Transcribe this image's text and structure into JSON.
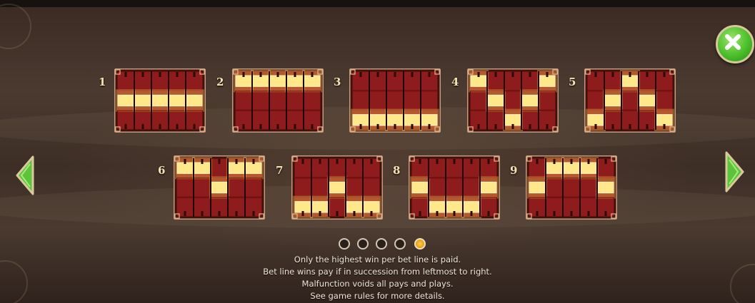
{
  "paylines": [
    {
      "label": "1",
      "rows": [
        1,
        1,
        1,
        1,
        1
      ]
    },
    {
      "label": "2",
      "rows": [
        0,
        0,
        0,
        0,
        0
      ]
    },
    {
      "label": "3",
      "rows": [
        2,
        2,
        2,
        2,
        2
      ]
    },
    {
      "label": "4",
      "rows": [
        0,
        1,
        2,
        1,
        0
      ]
    },
    {
      "label": "5",
      "rows": [
        2,
        1,
        0,
        1,
        2
      ]
    },
    {
      "label": "6",
      "rows": [
        0,
        0,
        1,
        0,
        0
      ]
    },
    {
      "label": "7",
      "rows": [
        2,
        2,
        1,
        2,
        2
      ]
    },
    {
      "label": "8",
      "rows": [
        1,
        2,
        2,
        2,
        1
      ]
    },
    {
      "label": "9",
      "rows": [
        1,
        0,
        0,
        0,
        1
      ]
    }
  ],
  "pagination": {
    "pages": 5,
    "current": 5
  },
  "info": {
    "line1": "Only the highest win per bet line is paid.",
    "line2": "Bet line wins pay if in succession from leftmost to right.",
    "line3": "Malfunction voids all pays and plays.",
    "line4": "See game rules for more details."
  },
  "icons": {
    "close": "close-icon",
    "prev": "arrow-left-icon",
    "next": "arrow-right-icon"
  },
  "colors": {
    "cell": "#8e1c1c",
    "highlight": "#ffe88a",
    "frame": "#c89a7a",
    "button": "#4bbf2a"
  }
}
